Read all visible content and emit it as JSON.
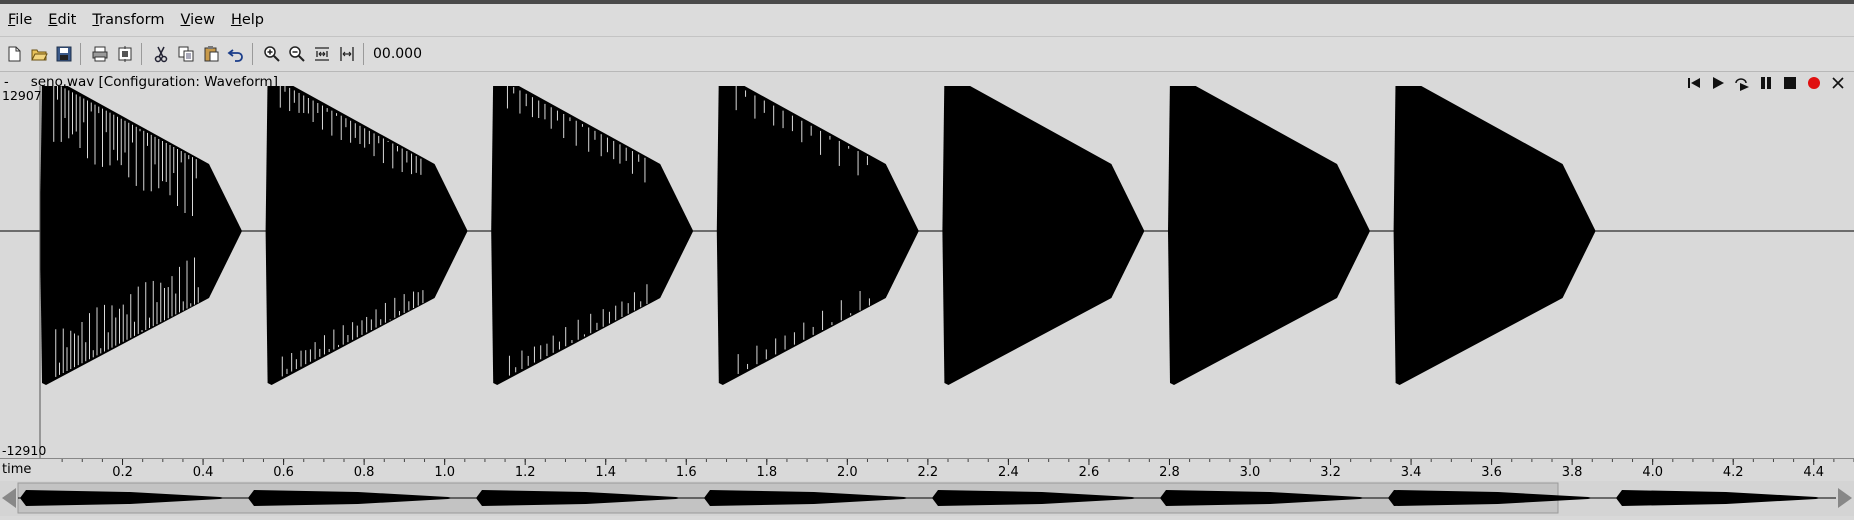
{
  "menu": [
    {
      "pre": "",
      "u": "F",
      "post": "ile"
    },
    {
      "pre": "",
      "u": "E",
      "post": "dit"
    },
    {
      "pre": "",
      "u": "T",
      "post": "ransform"
    },
    {
      "pre": "",
      "u": "V",
      "post": "iew"
    },
    {
      "pre": "",
      "u": "H",
      "post": "elp"
    }
  ],
  "toolbar": {
    "icons": [
      "new-file-icon",
      "open-file-icon",
      "save-icon",
      "print-icon",
      "print-setup-icon",
      "cut-icon",
      "copy-icon",
      "paste-icon",
      "undo-icon",
      "zoom-in-icon",
      "zoom-out-icon",
      "zoom-fit-icon",
      "zoom-selection-icon"
    ],
    "time_display": "00.000"
  },
  "window": {
    "dash": "-",
    "title": "seno.wav  [Configuration: Waveform]"
  },
  "transport": [
    "skip-back-icon",
    "play-icon",
    "loop-play-icon",
    "pause-icon",
    "stop-icon",
    "record-icon",
    "close-icon"
  ],
  "waveform": {
    "y_max": "12907",
    "y_min": "-12910",
    "segments": 7,
    "color": "#000000",
    "background": "#d9d9d9"
  },
  "time_axis": {
    "label": "time",
    "ticks": [
      "0.2",
      "0.4",
      "0.6",
      "0.8",
      "1.0",
      "1.2",
      "1.4",
      "1.6",
      "1.8",
      "2.0",
      "2.2",
      "2.4",
      "2.6",
      "2.8",
      "3.0",
      "3.2",
      "3.4",
      "3.6",
      "3.8",
      "4.0",
      "4.2",
      "4.4"
    ],
    "max_time": 4.5
  }
}
